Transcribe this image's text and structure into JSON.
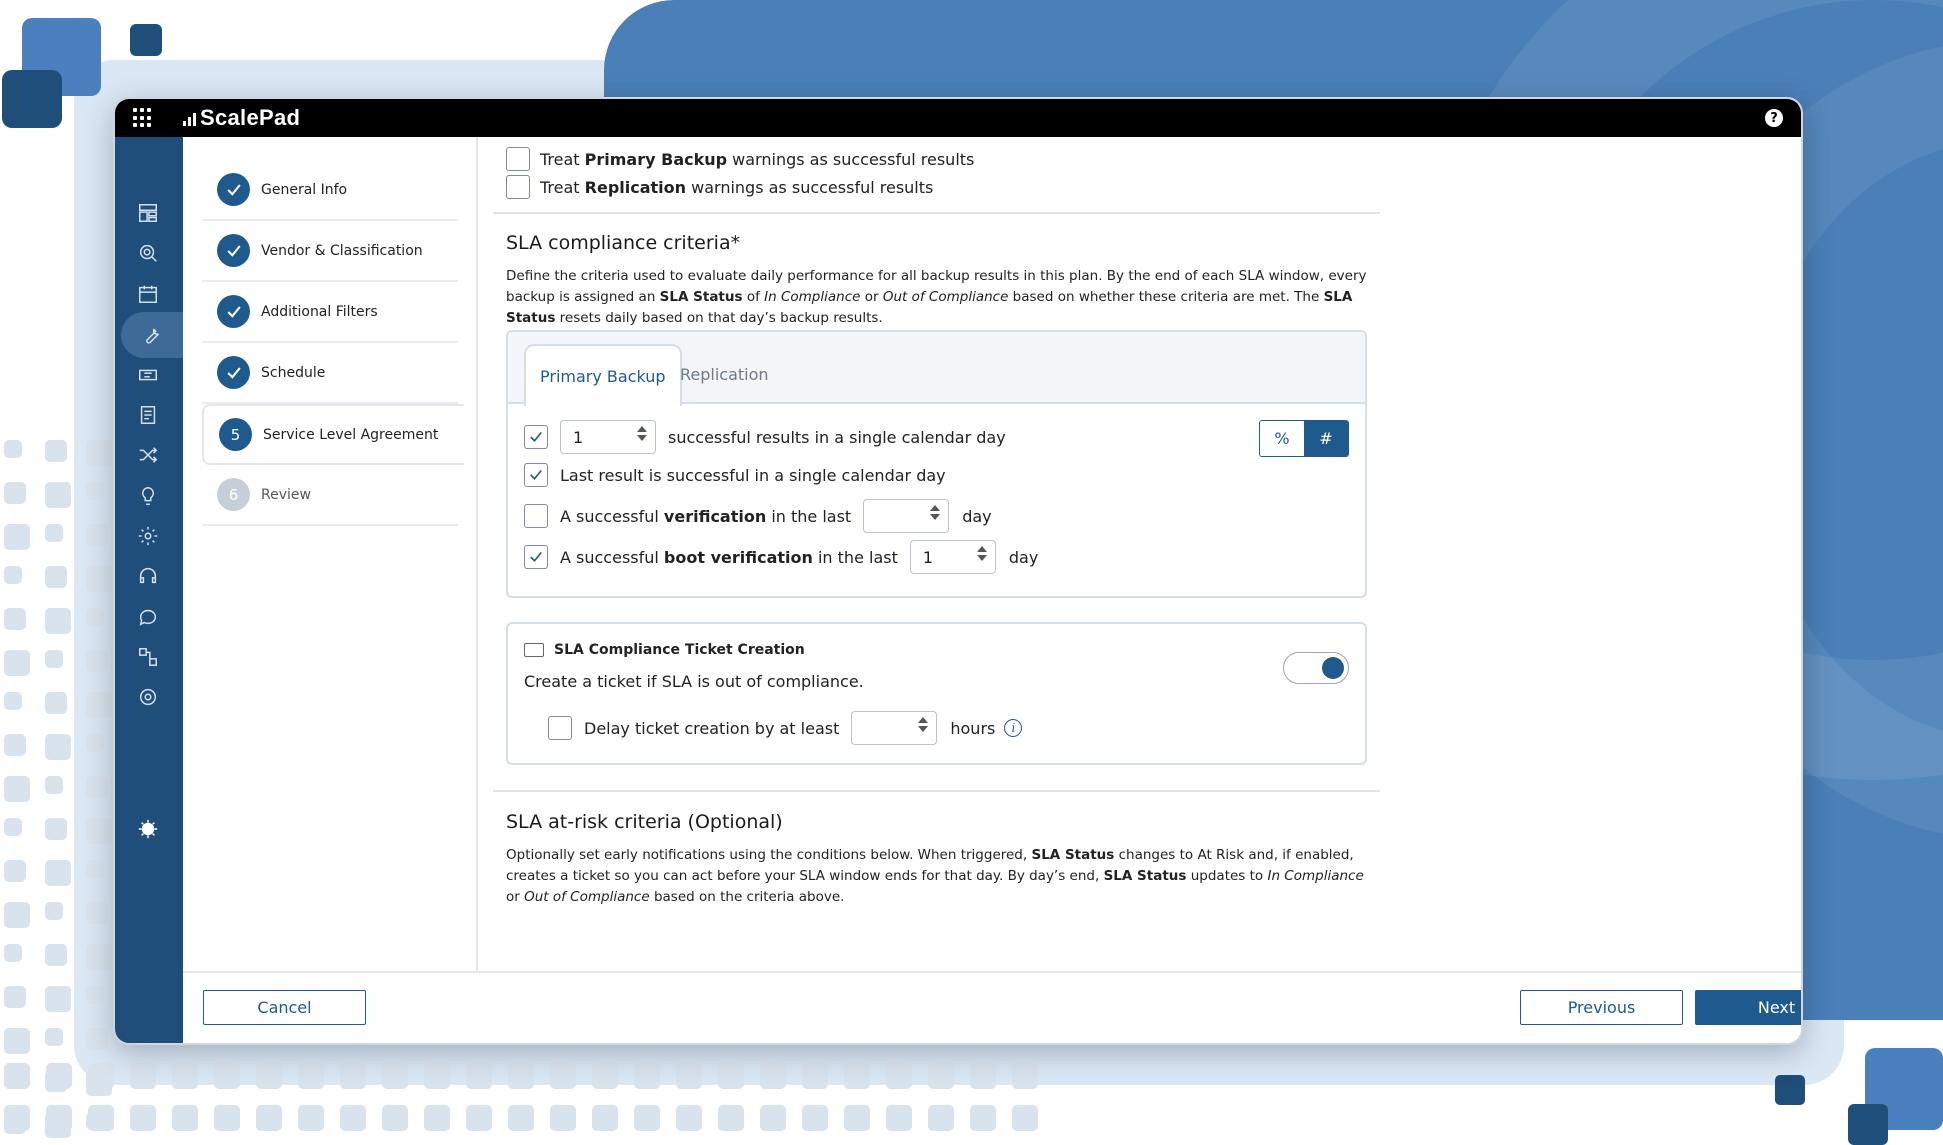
{
  "app": {
    "brand": "ScalePad"
  },
  "nav_icons": [
    "dashboard-icon",
    "monitor-search-icon",
    "calendar-icon",
    "wrench-icon",
    "ticket-icon",
    "report-icon",
    "shuffle-icon",
    "lightbulb-icon",
    "settings-cog-icon",
    "headset-icon",
    "chat-icon",
    "integrations-icon",
    "gear-icon",
    "theme-toggle-icon"
  ],
  "steps": [
    {
      "label": "General Info",
      "state": "done"
    },
    {
      "label": "Vendor & Classification",
      "state": "done"
    },
    {
      "label": "Additional Filters",
      "state": "done"
    },
    {
      "label": "Schedule",
      "state": "done"
    },
    {
      "label": "Service Level Agreement",
      "state": "current",
      "number": "5"
    },
    {
      "label": "Review",
      "state": "upcoming",
      "number": "6"
    }
  ],
  "warnings": {
    "primary": {
      "pre": "Treat ",
      "bold": "Primary Backup",
      "post": " warnings as successful results",
      "checked": false
    },
    "replication": {
      "pre": "Treat ",
      "bold": "Replication",
      "post": " warnings as successful results",
      "checked": false
    }
  },
  "sla": {
    "title": "SLA compliance criteria*",
    "desc": {
      "p1": "Define the criteria used to evaluate daily performance for all backup results in this plan. By the end of each SLA window, every backup is assigned an ",
      "b1": "SLA Status",
      "p2": " of ",
      "i1": "In Compliance",
      "p3": " or ",
      "i2": "Out of Compliance",
      "p4": " based on whether these criteria are met. The ",
      "b2": "SLA Status",
      "p5": " resets daily based on that day’s backup results."
    },
    "tabs": {
      "active": "Primary Backup",
      "inactive": "Replication"
    },
    "criteria": {
      "successful": {
        "checked": true,
        "value": "1",
        "label": "successful results in a single calendar day"
      },
      "last_result": {
        "checked": true,
        "label": "Last result is successful in a single calendar day"
      },
      "verification": {
        "checked": false,
        "pre": "A successful ",
        "bold": "verification",
        "post": " in the last",
        "value": "",
        "unit": "day"
      },
      "boot": {
        "checked": true,
        "pre": "A successful ",
        "bold": "boot verification",
        "post": " in the last",
        "value": "1",
        "unit": "day"
      }
    },
    "mode": {
      "percent": "%",
      "count": "#",
      "selected": "#"
    }
  },
  "ticket": {
    "title": "SLA Compliance Ticket Creation",
    "desc": "Create a ticket if SLA is out of compliance.",
    "enabled": true,
    "delay": {
      "checked": false,
      "label": "Delay ticket creation by at least",
      "value": "",
      "unit": "hours"
    }
  },
  "at_risk": {
    "title": "SLA at-risk criteria (Optional)",
    "desc": {
      "p1": "Optionally set early notifications using the conditions below. When triggered, ",
      "b1": "SLA Status",
      "p2": " changes to At Risk and, if enabled, creates a ticket so you can act before your SLA window ends for that day. By day’s end, ",
      "b2": "SLA Status",
      "p3": " updates to ",
      "i1": "In Compliance",
      "p4": " or ",
      "i2": "Out of Compliance",
      "p5": " based on the criteria above."
    }
  },
  "footer": {
    "cancel": "Cancel",
    "previous": "Previous",
    "next": "Next"
  },
  "colors": {
    "accent": "#1f5a8e",
    "nav_bg": "#1f4e7a",
    "topbar": "#000000"
  }
}
